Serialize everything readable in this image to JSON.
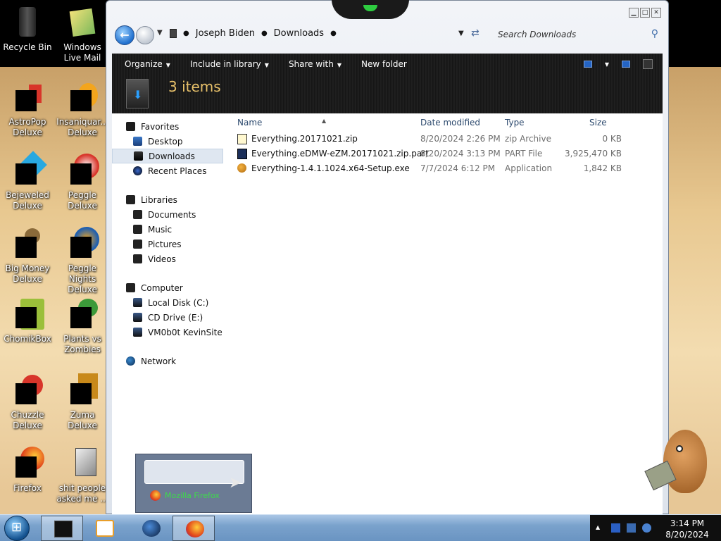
{
  "desktop": {
    "icons": [
      {
        "label": "Recycle Bin"
      },
      {
        "label": "Windows Live Mail"
      },
      {
        "label": "AstroPop Deluxe"
      },
      {
        "label": "Insaniquar... Deluxe"
      },
      {
        "label": "Bejeweled Deluxe"
      },
      {
        "label": "Peggle Deluxe"
      },
      {
        "label": "Big Money Deluxe"
      },
      {
        "label": "Peggle Nights Deluxe"
      },
      {
        "label": "ChomikBox"
      },
      {
        "label": "Plants vs Zombies"
      },
      {
        "label": "Chuzzle Deluxe"
      },
      {
        "label": "Zuma Deluxe"
      },
      {
        "label": "Firefox"
      },
      {
        "label": "shit people asked me ..."
      }
    ]
  },
  "explorer": {
    "breadcrumb": [
      "Joseph Biden",
      "Downloads"
    ],
    "search_placeholder": "Search Downloads",
    "toolbar": {
      "organize": "Organize",
      "include": "Include in library",
      "share": "Share with",
      "new_folder": "New folder"
    },
    "item_count": "3 items",
    "sidebar": {
      "favorites": {
        "header": "Favorites",
        "items": [
          "Desktop",
          "Downloads",
          "Recent Places"
        ]
      },
      "libraries": {
        "header": "Libraries",
        "items": [
          "Documents",
          "Music",
          "Pictures",
          "Videos"
        ]
      },
      "computer": {
        "header": "Computer",
        "items": [
          "Local Disk (C:)",
          "CD Drive (E:)",
          "VM0b0t KevinSite"
        ]
      },
      "network": {
        "header": "Network"
      }
    },
    "columns": {
      "name": "Name",
      "date": "Date modified",
      "type": "Type",
      "size": "Size"
    },
    "files": [
      {
        "name": "Everything.20171021.zip",
        "date": "8/20/2024 2:26 PM",
        "type": "zip Archive",
        "size": "0 KB",
        "icon": "zip-icon"
      },
      {
        "name": "Everything.eDMW-eZM.20171021.zip.part",
        "date": "8/20/2024 3:13 PM",
        "type": "PART File",
        "size": "3,925,470 KB",
        "icon": "part-file-icon"
      },
      {
        "name": "Everything-1.4.1.1024.x64-Setup.exe",
        "date": "7/7/2024 6:12 PM",
        "type": "Application",
        "size": "1,842 KB",
        "icon": "setup-exe-icon"
      }
    ]
  },
  "preview": {
    "label": "Mozilla Firefox"
  },
  "clock": {
    "time": "3:14 PM",
    "date": "8/20/2024"
  }
}
